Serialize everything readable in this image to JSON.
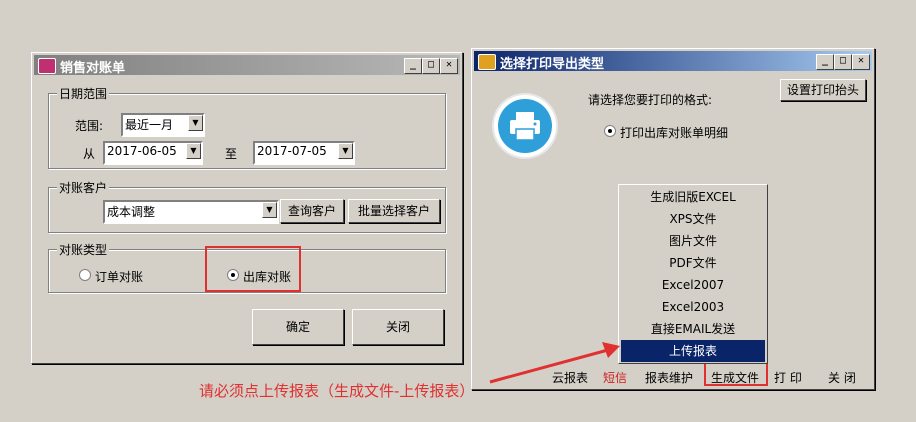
{
  "sales_window": {
    "title": "销售对账单",
    "date_group": {
      "label": "日期范围",
      "range_label": "范围:",
      "range_value": "最近一月",
      "from_label": "从",
      "from_date": "2017-06-05",
      "to_label": "至",
      "to_date": "2017-07-05"
    },
    "customer_group": {
      "label": "对账客户",
      "customer_value": "成本调整",
      "query_button": "查询客户",
      "batch_button": "批量选择客户"
    },
    "type_group": {
      "label": "对账类型",
      "order_option": "订单对账",
      "outbound_option": "出库对账",
      "selected": "出库对账"
    },
    "ok_button": "确定",
    "close_button": "关闭"
  },
  "print_window": {
    "title": "选择打印导出类型",
    "prompt": "请选择您要打印的格式:",
    "setup_button": "设置打印抬头",
    "format_option": "打印出库对账单明细",
    "menu_items": [
      "生成旧版EXCEL",
      "XPS文件",
      "图片文件",
      "PDF文件",
      "Excel2007",
      "Excel2003",
      "直接EMAIL发送",
      "上传报表"
    ],
    "selected_menu_item": "上传报表",
    "bottom_bar": {
      "cloud_report": "云报表",
      "sms": "短信",
      "report_maintain": "报表维护",
      "generate_file": "生成文件",
      "print": "打 印",
      "close": "关 闭"
    }
  },
  "annotation": {
    "text": "请必须点上传报表（生成文件-上传报表）",
    "color": "#e03030"
  },
  "colors": {
    "desktop": "#d4d0c8",
    "active_title": "#0a246a",
    "inactive_title": "#808080",
    "printer_icon_bg": "#2e9fd8"
  }
}
